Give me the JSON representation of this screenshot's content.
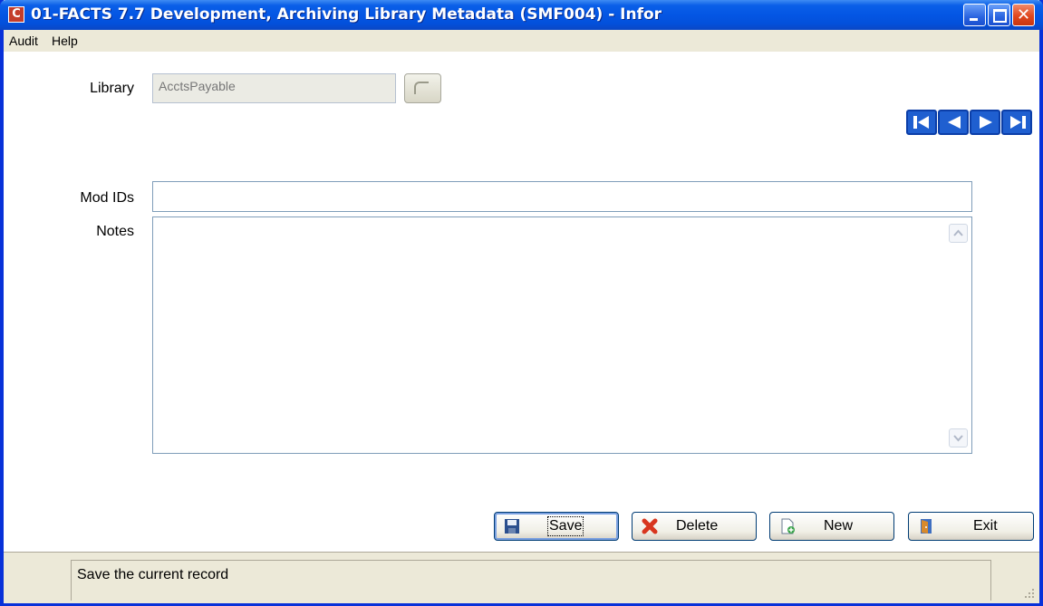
{
  "window": {
    "title": "01-FACTS 7.7 Development, Archiving Library Metadata (SMF004) - Infor",
    "app_icon_glyph": "C",
    "close_glyph": "✕"
  },
  "menu": {
    "items": [
      {
        "label": "Audit"
      },
      {
        "label": "Help"
      }
    ]
  },
  "form": {
    "library_label": "Library",
    "library_value": "AcctsPayable",
    "modids_label": "Mod IDs",
    "modids_value": "",
    "notes_label": "Notes",
    "notes_value": ""
  },
  "buttons": {
    "save": "Save",
    "delete": "Delete",
    "new": "New",
    "exit": "Exit"
  },
  "status": {
    "text": "Save the current record"
  },
  "colors": {
    "title_bar": "#0456e4",
    "window_face": "#ece9d8",
    "nav_blue": "#1f5fd0"
  }
}
